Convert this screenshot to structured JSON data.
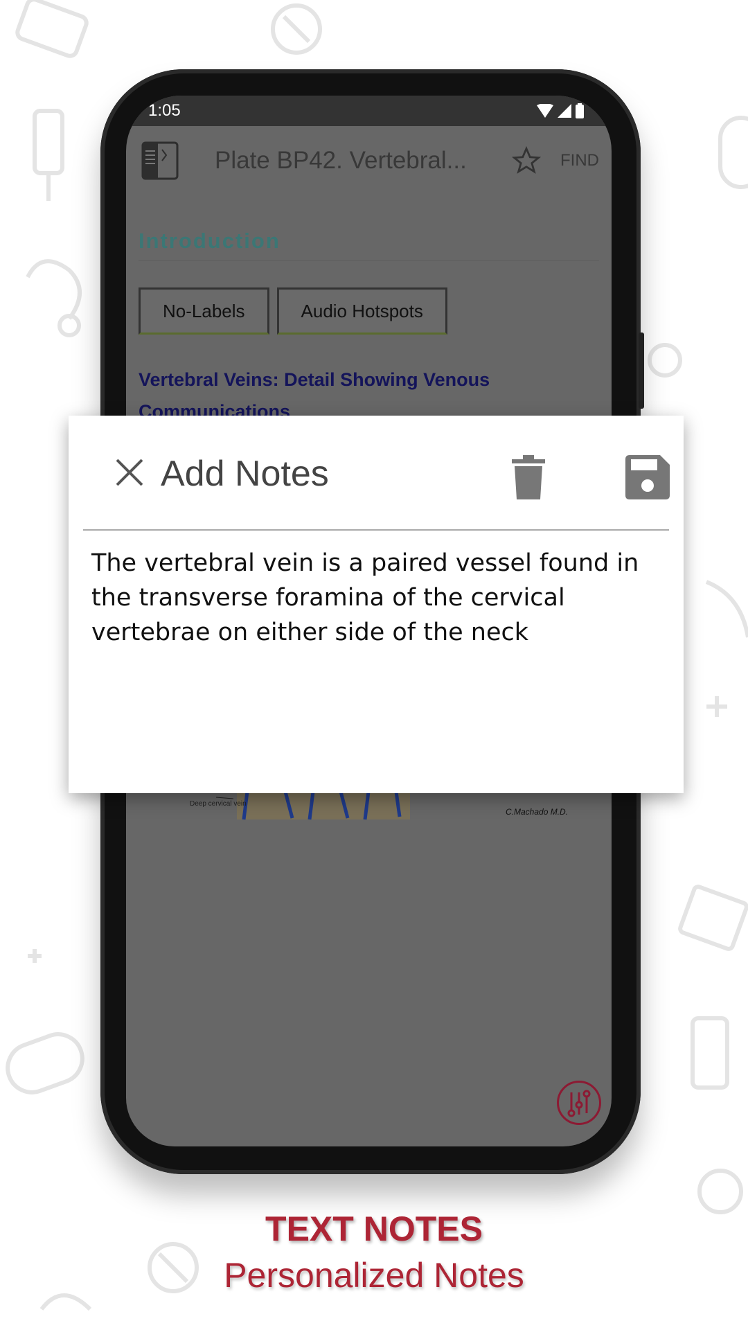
{
  "status_bar": {
    "time": "1:05"
  },
  "app_bar": {
    "title": "Plate BP42. Vertebral...",
    "find_label": "FIND"
  },
  "content": {
    "section_title": "Introduction",
    "buttons": [
      {
        "label": "No-Labels"
      },
      {
        "label": "Audio Hotspots"
      }
    ],
    "subheading": "Vertebral Veins: Detail Showing Venous Communications",
    "illustration_label": "Deep cervical vein",
    "signature": "C.Machado M.D."
  },
  "dialog": {
    "title": "Add Notes",
    "note_text": "The vertebral vein is a paired vessel found in the transverse foramina of the cervical vertebrae on either side of the neck"
  },
  "caption": {
    "headline": "TEXT NOTES",
    "subline": "Personalized Notes"
  },
  "colors": {
    "accent": "#ad2535",
    "section_title": "#3b7775",
    "overlay": "#676767"
  }
}
